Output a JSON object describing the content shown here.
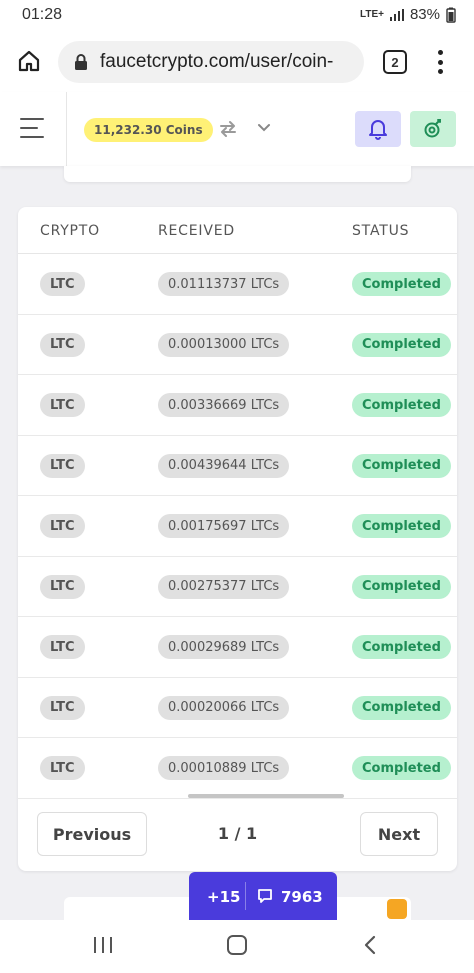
{
  "status_bar": {
    "time": "01:28",
    "network": "LTE+",
    "battery": "83%"
  },
  "browser": {
    "url": "faucetcrypto.com/user/coin-",
    "tab_count": "2"
  },
  "header": {
    "coins_label": "11,232.30 Coins"
  },
  "table": {
    "columns": [
      "CRYPTO",
      "RECEIVED",
      "STATUS"
    ],
    "rows": [
      {
        "crypto": "LTC",
        "received": "0.01113737 LTCs",
        "status": "Completed"
      },
      {
        "crypto": "LTC",
        "received": "0.00013000 LTCs",
        "status": "Completed"
      },
      {
        "crypto": "LTC",
        "received": "0.00336669 LTCs",
        "status": "Completed"
      },
      {
        "crypto": "LTC",
        "received": "0.00439644 LTCs",
        "status": "Completed"
      },
      {
        "crypto": "LTC",
        "received": "0.00175697 LTCs",
        "status": "Completed"
      },
      {
        "crypto": "LTC",
        "received": "0.00275377 LTCs",
        "status": "Completed"
      },
      {
        "crypto": "LTC",
        "received": "0.00029689 LTCs",
        "status": "Completed"
      },
      {
        "crypto": "LTC",
        "received": "0.00020066 LTCs",
        "status": "Completed"
      },
      {
        "crypto": "LTC",
        "received": "0.00010889 LTCs",
        "status": "Completed"
      }
    ]
  },
  "pagination": {
    "previous_label": "Previous",
    "page_info": "1 / 1",
    "next_label": "Next"
  },
  "chat": {
    "plus_label": "+15",
    "count": "7963"
  },
  "icons": {
    "home": "home-icon",
    "lock": "lock-icon",
    "menu": "more-vert-icon",
    "hamburger": "hamburger-icon",
    "swap": "swap-icon",
    "chevron": "chevron-down-icon",
    "bell": "bell-icon",
    "settings": "gear-icon",
    "chat": "chat-icon"
  },
  "colors": {
    "coins_badge": "#fff176",
    "status_completed_bg": "#b6f0cf",
    "status_completed_text": "#1f8e57",
    "chat_bar": "#4a3bdc"
  }
}
